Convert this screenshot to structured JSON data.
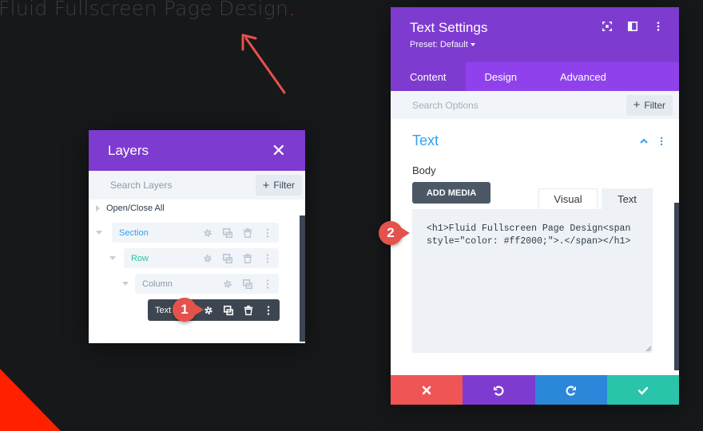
{
  "page": {
    "heading": "Fluid Fullscreen Page Design",
    "heading_dot": ".",
    "heading_dot_color": "#ff2000"
  },
  "layers": {
    "title": "Layers",
    "search_placeholder": "Search Layers",
    "filter_label": "Filter",
    "open_close_label": "Open/Close All",
    "items": [
      {
        "label": "Section",
        "color": "#2ea3f2"
      },
      {
        "label": "Row",
        "color": "#29c4a9"
      },
      {
        "label": "Column",
        "color": "#8e98a4"
      },
      {
        "label": "Text",
        "color": "#ffffff"
      }
    ]
  },
  "settings": {
    "title": "Text Settings",
    "preset": "Preset: Default",
    "tabs": [
      "Content",
      "Design",
      "Advanced"
    ],
    "active_tab": "Content",
    "search_placeholder": "Search Options",
    "filter_label": "Filter",
    "group_title": "Text",
    "body_label": "Body",
    "add_media_label": "ADD MEDIA",
    "editor_tabs": [
      "Visual",
      "Text"
    ],
    "editor_active_tab": "Text",
    "editor_content": "<h1>Fluid Fullscreen Page Design<span style=\"color: #ff2000;\">.</span></h1>"
  },
  "badges": [
    "1",
    "2"
  ],
  "colors": {
    "purple": "#7e3bd0",
    "purple_light": "#8f42ec",
    "blue": "#2ea3f2",
    "teal": "#29c4a9",
    "red": "#ef5555",
    "redo_blue": "#2b87da"
  },
  "icons": {
    "close": "close-icon",
    "gear": "gear-icon",
    "duplicate": "duplicate-icon",
    "trash": "trash-icon",
    "more": "more-icon",
    "expand": "expand-icon",
    "sidebar": "sidebar-icon",
    "undo": "undo-icon",
    "redo": "redo-icon",
    "check": "check-icon"
  }
}
